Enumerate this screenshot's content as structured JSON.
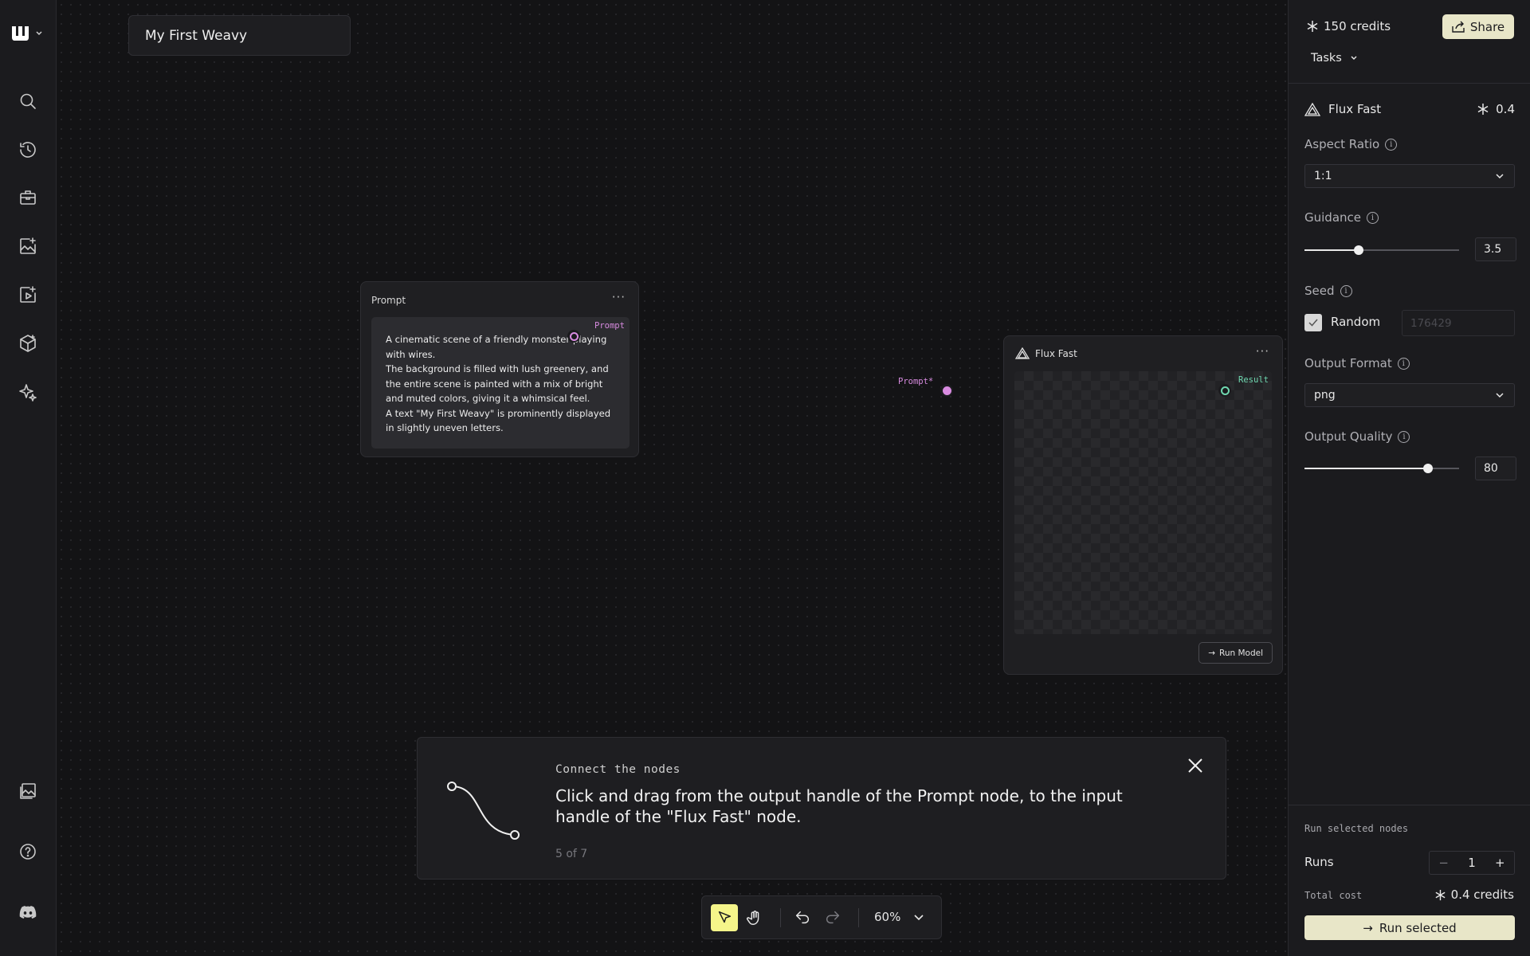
{
  "workflow": {
    "title": "My First Weavy"
  },
  "prompt_node": {
    "title": "Prompt",
    "menu": "···",
    "text": "A cinematic scene of a friendly monster playing with wires.\n The background is filled with lush greenery, and the entire scene is painted with a mix of bright and muted colors, giving it a whimsical feel.\n A text \"My First Weavy\" is prominently displayed in slightly uneven letters.",
    "output_handle_label": "Prompt"
  },
  "flux_node": {
    "title": "Flux Fast",
    "menu": "···",
    "input_handle_label": "Prompt*",
    "output_handle_label": "Result",
    "run_label": "Run Model"
  },
  "tutorial": {
    "step_title": "Connect the nodes",
    "body": "Click and drag from the output handle of the Prompt node, to the input handle of the \"Flux Fast\" node.",
    "progress": "5 of 7"
  },
  "toolbar": {
    "zoom": "60%"
  },
  "panel": {
    "credits": "150 credits",
    "share_label": "Share",
    "tasks_label": "Tasks",
    "model_name": "Flux Fast",
    "model_cost": "0.4",
    "aspect_ratio": {
      "label": "Aspect Ratio",
      "value": "1:1"
    },
    "guidance": {
      "label": "Guidance",
      "value": "3.5",
      "fraction": 0.35
    },
    "seed": {
      "label": "Seed",
      "random_label": "Random",
      "random_checked": true,
      "value": "176429"
    },
    "output_format": {
      "label": "Output Format",
      "value": "png"
    },
    "output_quality": {
      "label": "Output Quality",
      "value": "80",
      "fraction": 0.8
    },
    "run_section_title": "Run selected nodes",
    "runs_label": "Runs",
    "runs_value": "1",
    "total_cost_label": "Total cost",
    "total_cost_value": "0.4 credits",
    "run_selected_label": "Run selected"
  },
  "colors": {
    "accent": "#e8e6c8",
    "prompt_handle": "#d88be0",
    "result_handle": "#6fd8b0",
    "select_tool": "#f5f58a"
  }
}
